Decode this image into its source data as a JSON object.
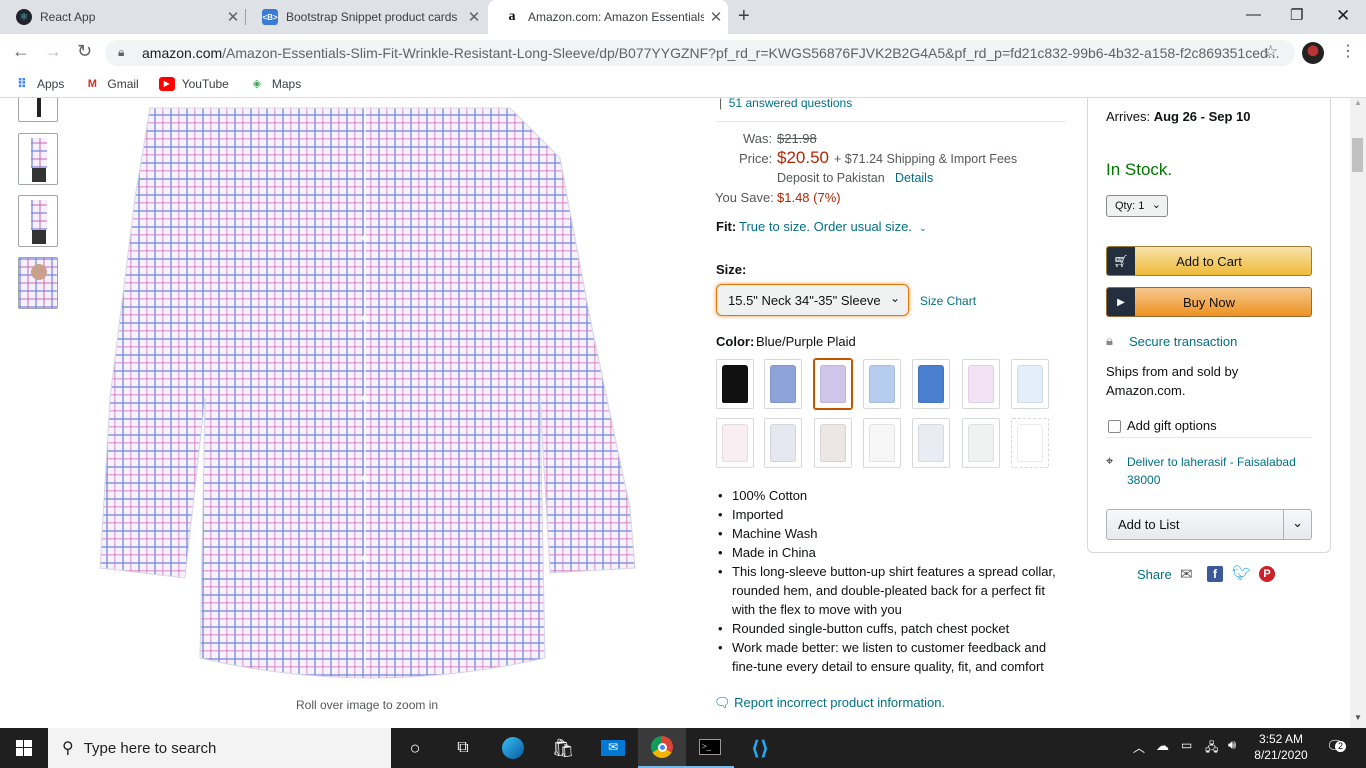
{
  "tabs": [
    {
      "title": "React App",
      "icon": "react-icon"
    },
    {
      "title": "Bootstrap Snippet product cards",
      "icon": "bootstrap-icon"
    },
    {
      "title": "Amazon.com: Amazon Essentials",
      "icon": "amazon-icon",
      "active": true
    }
  ],
  "url": {
    "domain": "amazon.com",
    "path": "/Amazon-Essentials-Slim-Fit-Wrinkle-Resistant-Long-Sleeve/dp/B077YYGZNF?pf_rd_r=KWGS56876FJVK2B2G4A5&pf_rd_p=fd21c832-99b6-4b32-a158-f2c869351ced..."
  },
  "bookmarks": [
    {
      "label": "Apps",
      "icon": "apps-grid-icon"
    },
    {
      "label": "Gmail",
      "icon": "gmail-icon"
    },
    {
      "label": "YouTube",
      "icon": "youtube-icon"
    },
    {
      "label": "Maps",
      "icon": "maps-icon"
    }
  ],
  "gallery": {
    "zoom_hint": "Roll over image to zoom in"
  },
  "product": {
    "answered_questions": "51 answered questions",
    "was_label": "Was:",
    "was_price": "$21.98",
    "price_label": "Price:",
    "price": "$20.50",
    "shipping": "+ $71.24 Shipping & Import Fees",
    "deposit": "Deposit to Pakistan",
    "details_link": "Details",
    "save_label": "You Save:",
    "save_value": "$1.48 (7%)",
    "fit_label": "Fit:",
    "fit_value": "True to size. Order usual size.",
    "size_label": "Size:",
    "size_selected": "15.5\" Neck 34\"-35\" Sleeve",
    "size_chart": "Size Chart",
    "color_label": "Color:",
    "color_value": "Blue/Purple Plaid",
    "swatches": [
      {
        "color": "#111111",
        "selected": false
      },
      {
        "color": "#8ea3d8",
        "selected": false
      },
      {
        "color": "#cdc6ea",
        "selected": true
      },
      {
        "color": "#b7cdef",
        "selected": false
      },
      {
        "color": "#4a7fd0",
        "selected": false
      },
      {
        "color": "#f1e3f5",
        "selected": false
      },
      {
        "color": "#e3eefa",
        "selected": false
      },
      {
        "color": "#f9eef1",
        "selected": false
      },
      {
        "color": "#e6e8ef",
        "selected": false
      },
      {
        "color": "#ece6e4",
        "selected": false
      },
      {
        "color": "#f6f6f6",
        "selected": false
      },
      {
        "color": "#e9ecf2",
        "selected": false
      },
      {
        "color": "#f0f1f1",
        "selected": false
      },
      {
        "color": "#ffffff",
        "selected": false
      }
    ],
    "bullets": [
      "100% Cotton",
      "Imported",
      "Machine Wash",
      "Made in China",
      "This long-sleeve button-up shirt features a spread collar, rounded hem, and double-pleated back for a perfect fit with the flex to move with you",
      "Rounded single-button cuffs, patch chest pocket",
      "Work made better: we listen to customer feedback and fine-tune every detail to ensure quality, fit, and comfort"
    ],
    "report_link": "Report incorrect product information."
  },
  "buybox": {
    "arrives_label": "Arrives:",
    "arrives_date": "Aug 26 - Sep 10",
    "stock": "In Stock.",
    "qty": "Qty: 1",
    "add_to_cart": "Add to Cart",
    "buy_now": "Buy Now",
    "secure": "Secure transaction",
    "ships_from": "Ships from and sold by Amazon.com.",
    "gift": "Add gift options",
    "deliver": "Deliver to laherasif - Faisalabad 38000",
    "add_to_list": "Add to List",
    "share": "Share"
  },
  "taskbar": {
    "search_placeholder": "Type here to search",
    "time": "3:52 AM",
    "date": "8/21/2020",
    "notifications": "2"
  },
  "colors": {
    "price": "#b12704",
    "link": "#007185",
    "in_stock": "#007600",
    "cart_button": "#f7ca00",
    "buy_button": "#f0a93b"
  }
}
